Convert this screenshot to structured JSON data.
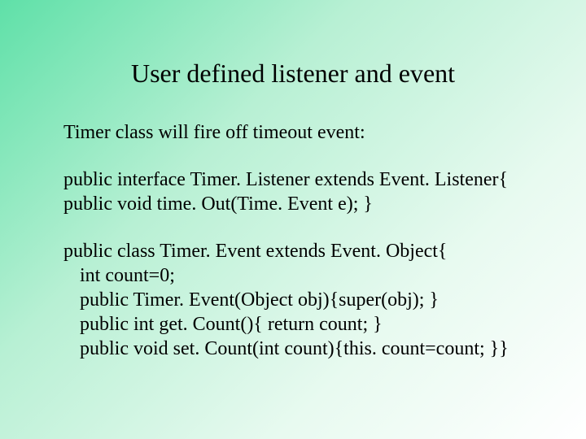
{
  "title": "User defined listener and event",
  "para1": "Timer class will fire off timeout event:",
  "iface_line1": "public interface Timer. Listener extends Event. Listener{",
  "iface_line2": " public void time. Out(Time. Event e); }",
  "cls_line1": "public class Timer. Event extends Event. Object{",
  "cls_line2": "int count=0;",
  "cls_line3": "public Timer. Event(Object obj){super(obj); }",
  "cls_line4": "public int get. Count(){ return count; }",
  "cls_line5": "public void set. Count(int count){this. count=count; }}"
}
